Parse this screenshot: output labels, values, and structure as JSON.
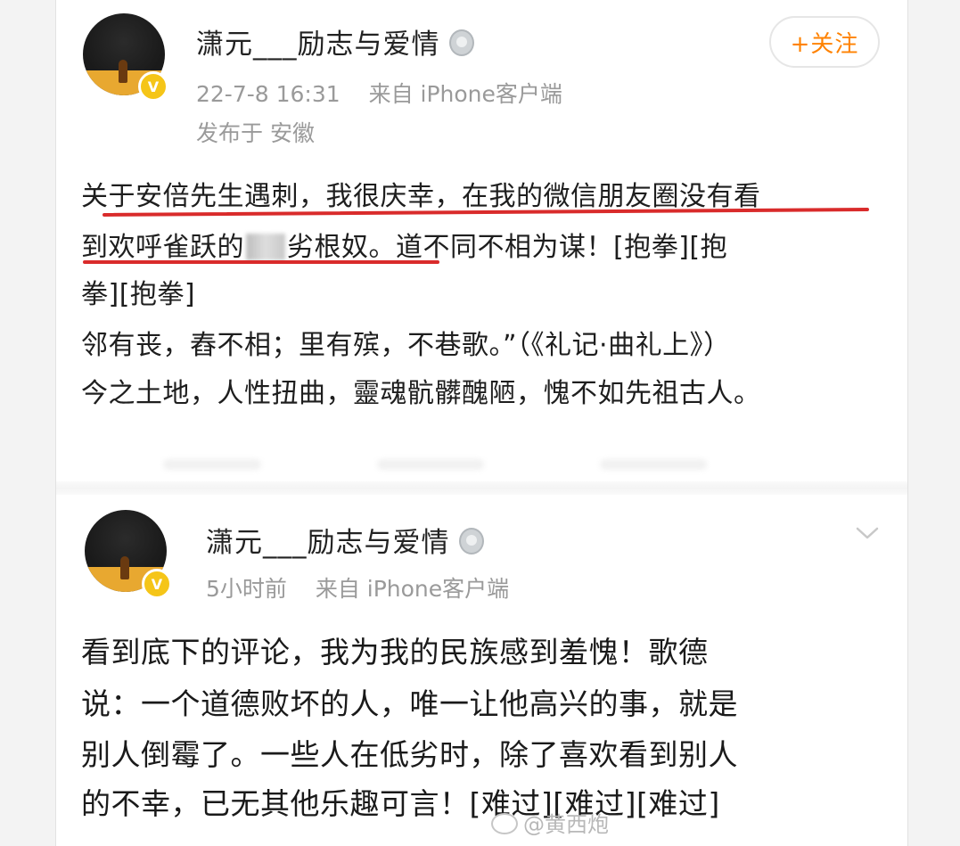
{
  "post1": {
    "username": "潇元___励志与爱情",
    "time": "22-7-8 16:31",
    "source": "来自 iPhone客户端",
    "location": "发布于 安徽",
    "follow_label": "+关注",
    "line1": "关于安倍先生遇刺，我很庆幸，在我的微信朋友圈没有看",
    "line2a": "到欢呼雀跃的",
    "line2b": "劣根奴。道不同不相为谋！[抱拳][抱",
    "line3": "拳][抱拳]",
    "line4": "邻有丧，舂不相；里有殡，不巷歌。”（《礼记·曲礼上》）",
    "line5": "今之土地，人性扭曲，靈魂骯髒醜陋，愧不如先祖古人。"
  },
  "post2": {
    "username": "潇元___励志与爱情",
    "time": "5小时前",
    "source": "来自 iPhone客户端",
    "line1": "看到底下的评论，我为我的民族感到羞愧！歌德",
    "line2": "说：一个道德败坏的人，唯一让他高兴的事，就是",
    "line3": "别人倒霉了。一些人在低劣时，除了喜欢看到别人",
    "line4": "的不幸，已无其他乐趣可言！[难过][难过][难过]"
  },
  "watermark": "@黄西炮",
  "colors": {
    "accent_orange": "#ff8200",
    "underline_red": "#d92b2b",
    "verified_badge": "#f5c518",
    "meta_gray": "#9a9a9a"
  },
  "icons": {
    "verified": "V",
    "medal": "medal-icon",
    "chevron": "chevron-down-icon",
    "weibo": "weibo-icon"
  }
}
